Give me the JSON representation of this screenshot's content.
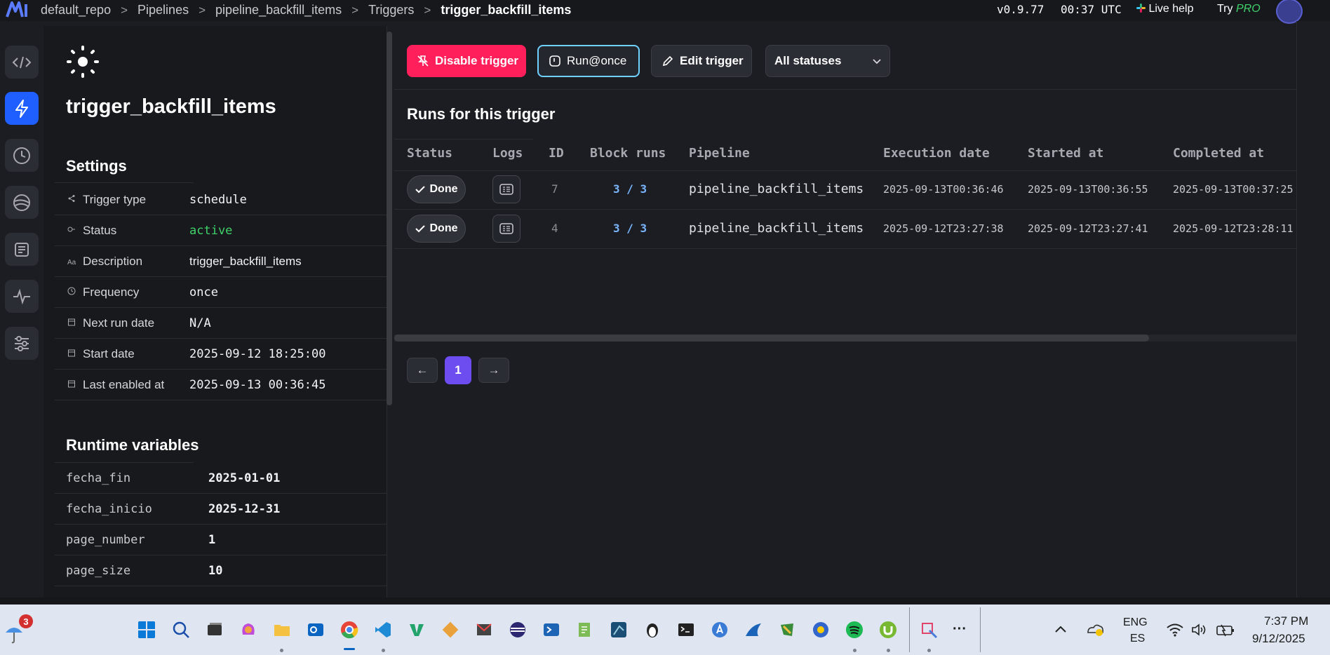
{
  "topbar": {
    "breadcrumbs": [
      "default_repo",
      "Pipelines",
      "pipeline_backfill_items",
      "Triggers"
    ],
    "current": "trigger_backfill_items",
    "separator": ">",
    "version": "v0.9.77",
    "time": "00:37 UTC",
    "live_help": "Live help",
    "try_label": "Try",
    "pro_label": "PRO"
  },
  "rail": {
    "items": [
      {
        "icon": "code-icon"
      },
      {
        "icon": "lightning-icon",
        "active": true
      },
      {
        "icon": "clock-icon"
      },
      {
        "icon": "globe-icon"
      },
      {
        "icon": "terminal-scroll-icon"
      },
      {
        "icon": "pulse-icon"
      },
      {
        "icon": "sliders-icon"
      }
    ]
  },
  "trigger": {
    "title": "trigger_backfill_items",
    "settings_title": "Settings",
    "settings": [
      {
        "icon": "share-icon",
        "label": "Trigger type",
        "value": "schedule",
        "mono": true
      },
      {
        "icon": "status-icon",
        "label": "Status",
        "value": "active",
        "mono": true,
        "color": "#3fd26a"
      },
      {
        "icon": "text-icon",
        "label": "Description",
        "value": "trigger_backfill_items",
        "mono": false
      },
      {
        "icon": "clock-icon",
        "label": "Frequency",
        "value": "once",
        "mono": true
      },
      {
        "icon": "calendar-icon",
        "label": "Next run date",
        "value": "N/A",
        "mono": true
      },
      {
        "icon": "calendar-icon",
        "label": "Start date",
        "value": "2025-09-12 18:25:00",
        "mono": true
      },
      {
        "icon": "calendar-icon",
        "label": "Last enabled at",
        "value": "2025-09-13 00:36:45",
        "mono": true
      }
    ],
    "runtime_title": "Runtime variables",
    "runtime_variables": [
      {
        "key": "fecha_fin",
        "value": "2025-01-01"
      },
      {
        "key": "fecha_inicio",
        "value": "2025-12-31"
      },
      {
        "key": "page_number",
        "value": "1"
      },
      {
        "key": "page_size",
        "value": "10"
      }
    ]
  },
  "actions": {
    "disable": "Disable trigger",
    "run_once": "Run@once",
    "edit": "Edit trigger",
    "status_filter": "All statuses"
  },
  "runs": {
    "title": "Runs for this trigger",
    "columns": [
      "Status",
      "Logs",
      "ID",
      "Block runs",
      "Pipeline",
      "Execution date",
      "Started at",
      "Completed at"
    ],
    "rows": [
      {
        "status": "Done",
        "id": "7",
        "block_runs": "3 / 3",
        "pipeline": "pipeline_backfill_items",
        "execution_date": "2025-09-13T00:36:46",
        "started_at": "2025-09-13T00:36:55",
        "completed_at": "2025-09-13T00:37:25"
      },
      {
        "status": "Done",
        "id": "4",
        "block_runs": "3 / 3",
        "pipeline": "pipeline_backfill_items",
        "execution_date": "2025-09-12T23:27:38",
        "started_at": "2025-09-12T23:27:41",
        "completed_at": "2025-09-12T23:28:11"
      }
    ]
  },
  "pagination": {
    "prev": "←",
    "current": "1",
    "next": "→"
  },
  "taskbar": {
    "weather_badge": "3",
    "lang_top": "ENG",
    "lang_bottom": "ES",
    "clock_time": "7:37 PM",
    "clock_date": "9/12/2025",
    "more": "···"
  },
  "colors": {
    "accent_blue": "#1f5fff",
    "danger": "#ff1f5a",
    "active_green": "#3fd26a",
    "page_purple": "#6d4df0",
    "run_once_border": "#6fd1ff"
  }
}
